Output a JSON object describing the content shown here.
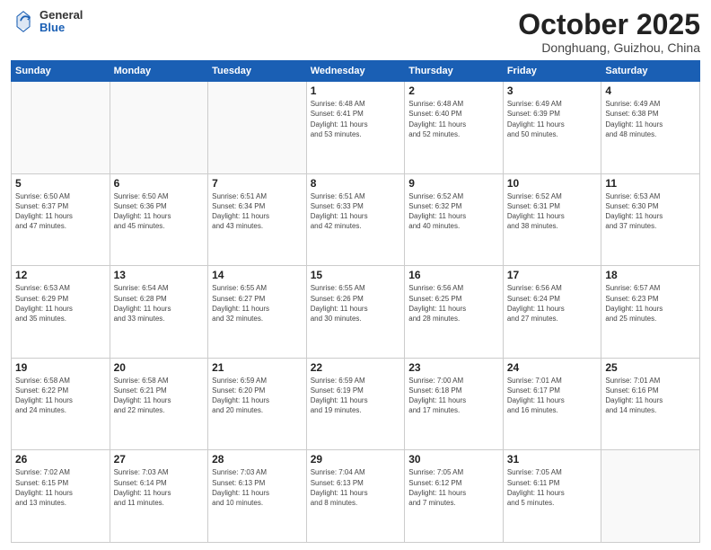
{
  "logo": {
    "general": "General",
    "blue": "Blue"
  },
  "header": {
    "month": "October 2025",
    "location": "Donghuang, Guizhou, China"
  },
  "weekdays": [
    "Sunday",
    "Monday",
    "Tuesday",
    "Wednesday",
    "Thursday",
    "Friday",
    "Saturday"
  ],
  "weeks": [
    [
      {
        "day": "",
        "info": ""
      },
      {
        "day": "",
        "info": ""
      },
      {
        "day": "",
        "info": ""
      },
      {
        "day": "1",
        "info": "Sunrise: 6:48 AM\nSunset: 6:41 PM\nDaylight: 11 hours\nand 53 minutes."
      },
      {
        "day": "2",
        "info": "Sunrise: 6:48 AM\nSunset: 6:40 PM\nDaylight: 11 hours\nand 52 minutes."
      },
      {
        "day": "3",
        "info": "Sunrise: 6:49 AM\nSunset: 6:39 PM\nDaylight: 11 hours\nand 50 minutes."
      },
      {
        "day": "4",
        "info": "Sunrise: 6:49 AM\nSunset: 6:38 PM\nDaylight: 11 hours\nand 48 minutes."
      }
    ],
    [
      {
        "day": "5",
        "info": "Sunrise: 6:50 AM\nSunset: 6:37 PM\nDaylight: 11 hours\nand 47 minutes."
      },
      {
        "day": "6",
        "info": "Sunrise: 6:50 AM\nSunset: 6:36 PM\nDaylight: 11 hours\nand 45 minutes."
      },
      {
        "day": "7",
        "info": "Sunrise: 6:51 AM\nSunset: 6:34 PM\nDaylight: 11 hours\nand 43 minutes."
      },
      {
        "day": "8",
        "info": "Sunrise: 6:51 AM\nSunset: 6:33 PM\nDaylight: 11 hours\nand 42 minutes."
      },
      {
        "day": "9",
        "info": "Sunrise: 6:52 AM\nSunset: 6:32 PM\nDaylight: 11 hours\nand 40 minutes."
      },
      {
        "day": "10",
        "info": "Sunrise: 6:52 AM\nSunset: 6:31 PM\nDaylight: 11 hours\nand 38 minutes."
      },
      {
        "day": "11",
        "info": "Sunrise: 6:53 AM\nSunset: 6:30 PM\nDaylight: 11 hours\nand 37 minutes."
      }
    ],
    [
      {
        "day": "12",
        "info": "Sunrise: 6:53 AM\nSunset: 6:29 PM\nDaylight: 11 hours\nand 35 minutes."
      },
      {
        "day": "13",
        "info": "Sunrise: 6:54 AM\nSunset: 6:28 PM\nDaylight: 11 hours\nand 33 minutes."
      },
      {
        "day": "14",
        "info": "Sunrise: 6:55 AM\nSunset: 6:27 PM\nDaylight: 11 hours\nand 32 minutes."
      },
      {
        "day": "15",
        "info": "Sunrise: 6:55 AM\nSunset: 6:26 PM\nDaylight: 11 hours\nand 30 minutes."
      },
      {
        "day": "16",
        "info": "Sunrise: 6:56 AM\nSunset: 6:25 PM\nDaylight: 11 hours\nand 28 minutes."
      },
      {
        "day": "17",
        "info": "Sunrise: 6:56 AM\nSunset: 6:24 PM\nDaylight: 11 hours\nand 27 minutes."
      },
      {
        "day": "18",
        "info": "Sunrise: 6:57 AM\nSunset: 6:23 PM\nDaylight: 11 hours\nand 25 minutes."
      }
    ],
    [
      {
        "day": "19",
        "info": "Sunrise: 6:58 AM\nSunset: 6:22 PM\nDaylight: 11 hours\nand 24 minutes."
      },
      {
        "day": "20",
        "info": "Sunrise: 6:58 AM\nSunset: 6:21 PM\nDaylight: 11 hours\nand 22 minutes."
      },
      {
        "day": "21",
        "info": "Sunrise: 6:59 AM\nSunset: 6:20 PM\nDaylight: 11 hours\nand 20 minutes."
      },
      {
        "day": "22",
        "info": "Sunrise: 6:59 AM\nSunset: 6:19 PM\nDaylight: 11 hours\nand 19 minutes."
      },
      {
        "day": "23",
        "info": "Sunrise: 7:00 AM\nSunset: 6:18 PM\nDaylight: 11 hours\nand 17 minutes."
      },
      {
        "day": "24",
        "info": "Sunrise: 7:01 AM\nSunset: 6:17 PM\nDaylight: 11 hours\nand 16 minutes."
      },
      {
        "day": "25",
        "info": "Sunrise: 7:01 AM\nSunset: 6:16 PM\nDaylight: 11 hours\nand 14 minutes."
      }
    ],
    [
      {
        "day": "26",
        "info": "Sunrise: 7:02 AM\nSunset: 6:15 PM\nDaylight: 11 hours\nand 13 minutes."
      },
      {
        "day": "27",
        "info": "Sunrise: 7:03 AM\nSunset: 6:14 PM\nDaylight: 11 hours\nand 11 minutes."
      },
      {
        "day": "28",
        "info": "Sunrise: 7:03 AM\nSunset: 6:13 PM\nDaylight: 11 hours\nand 10 minutes."
      },
      {
        "day": "29",
        "info": "Sunrise: 7:04 AM\nSunset: 6:13 PM\nDaylight: 11 hours\nand 8 minutes."
      },
      {
        "day": "30",
        "info": "Sunrise: 7:05 AM\nSunset: 6:12 PM\nDaylight: 11 hours\nand 7 minutes."
      },
      {
        "day": "31",
        "info": "Sunrise: 7:05 AM\nSunset: 6:11 PM\nDaylight: 11 hours\nand 5 minutes."
      },
      {
        "day": "",
        "info": ""
      }
    ]
  ]
}
